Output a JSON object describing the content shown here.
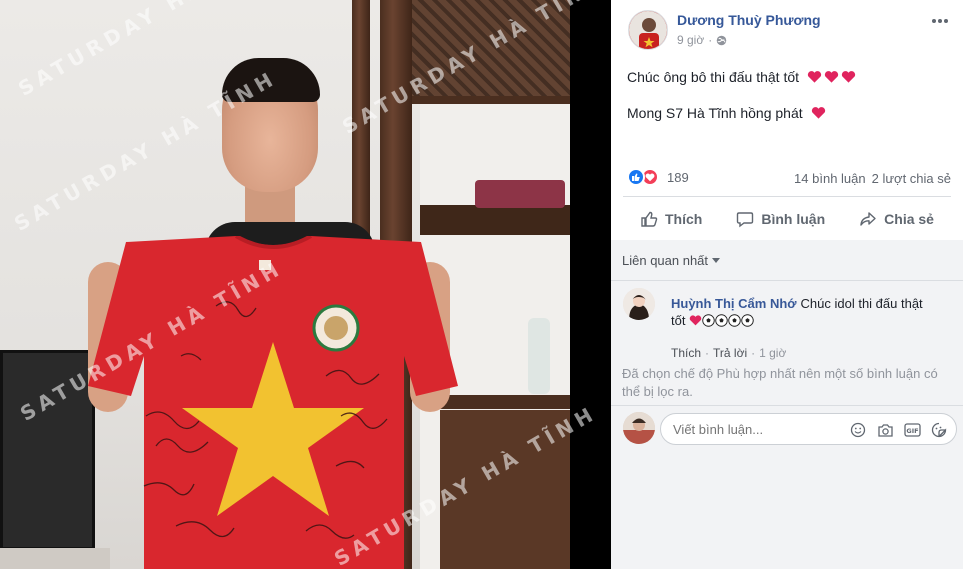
{
  "photo": {
    "watermark_text": "SATURDAY HÀ TĨNH",
    "description_alt": "Player holding a signed red jersey with a yellow star"
  },
  "post": {
    "author": "Dương Thuỳ Phương",
    "time": "9 giờ",
    "privacy_icon": "globe-icon",
    "lines": [
      {
        "text": "Chúc ông bô thi đấu thật tốt",
        "hearts": 3
      },
      {
        "text": "Mong S7 Hà Tĩnh hồng phát",
        "hearts": 1
      }
    ]
  },
  "reactions": {
    "count": "189",
    "comments": "14 bình luận",
    "shares": "2 lượt chia sẻ"
  },
  "actions": {
    "like": "Thích",
    "comment": "Bình luận",
    "share": "Chia sẻ"
  },
  "comments_section": {
    "sort_label": "Liên quan nhất",
    "items": [
      {
        "author": "Huỳnh Thị Cẩm Nhớ",
        "text": "Chúc idol thi đấu thật tốt",
        "emoji": "heart-and-soccer-balls",
        "like_label": "Thích",
        "reply_label": "Trả lời",
        "time": "1 giờ"
      }
    ],
    "filter_note": "Đã chọn chế độ Phù hợp nhất nên một số bình luận có thể bị lọc ra.",
    "compose_placeholder": "Viết bình luận..."
  },
  "colors": {
    "link_blue": "#365899",
    "like_blue": "#1877f2",
    "love_red": "#f33e58",
    "heart_red": "#e0245e",
    "shirt_red": "#d9272e",
    "star_yellow": "#f2c230"
  }
}
